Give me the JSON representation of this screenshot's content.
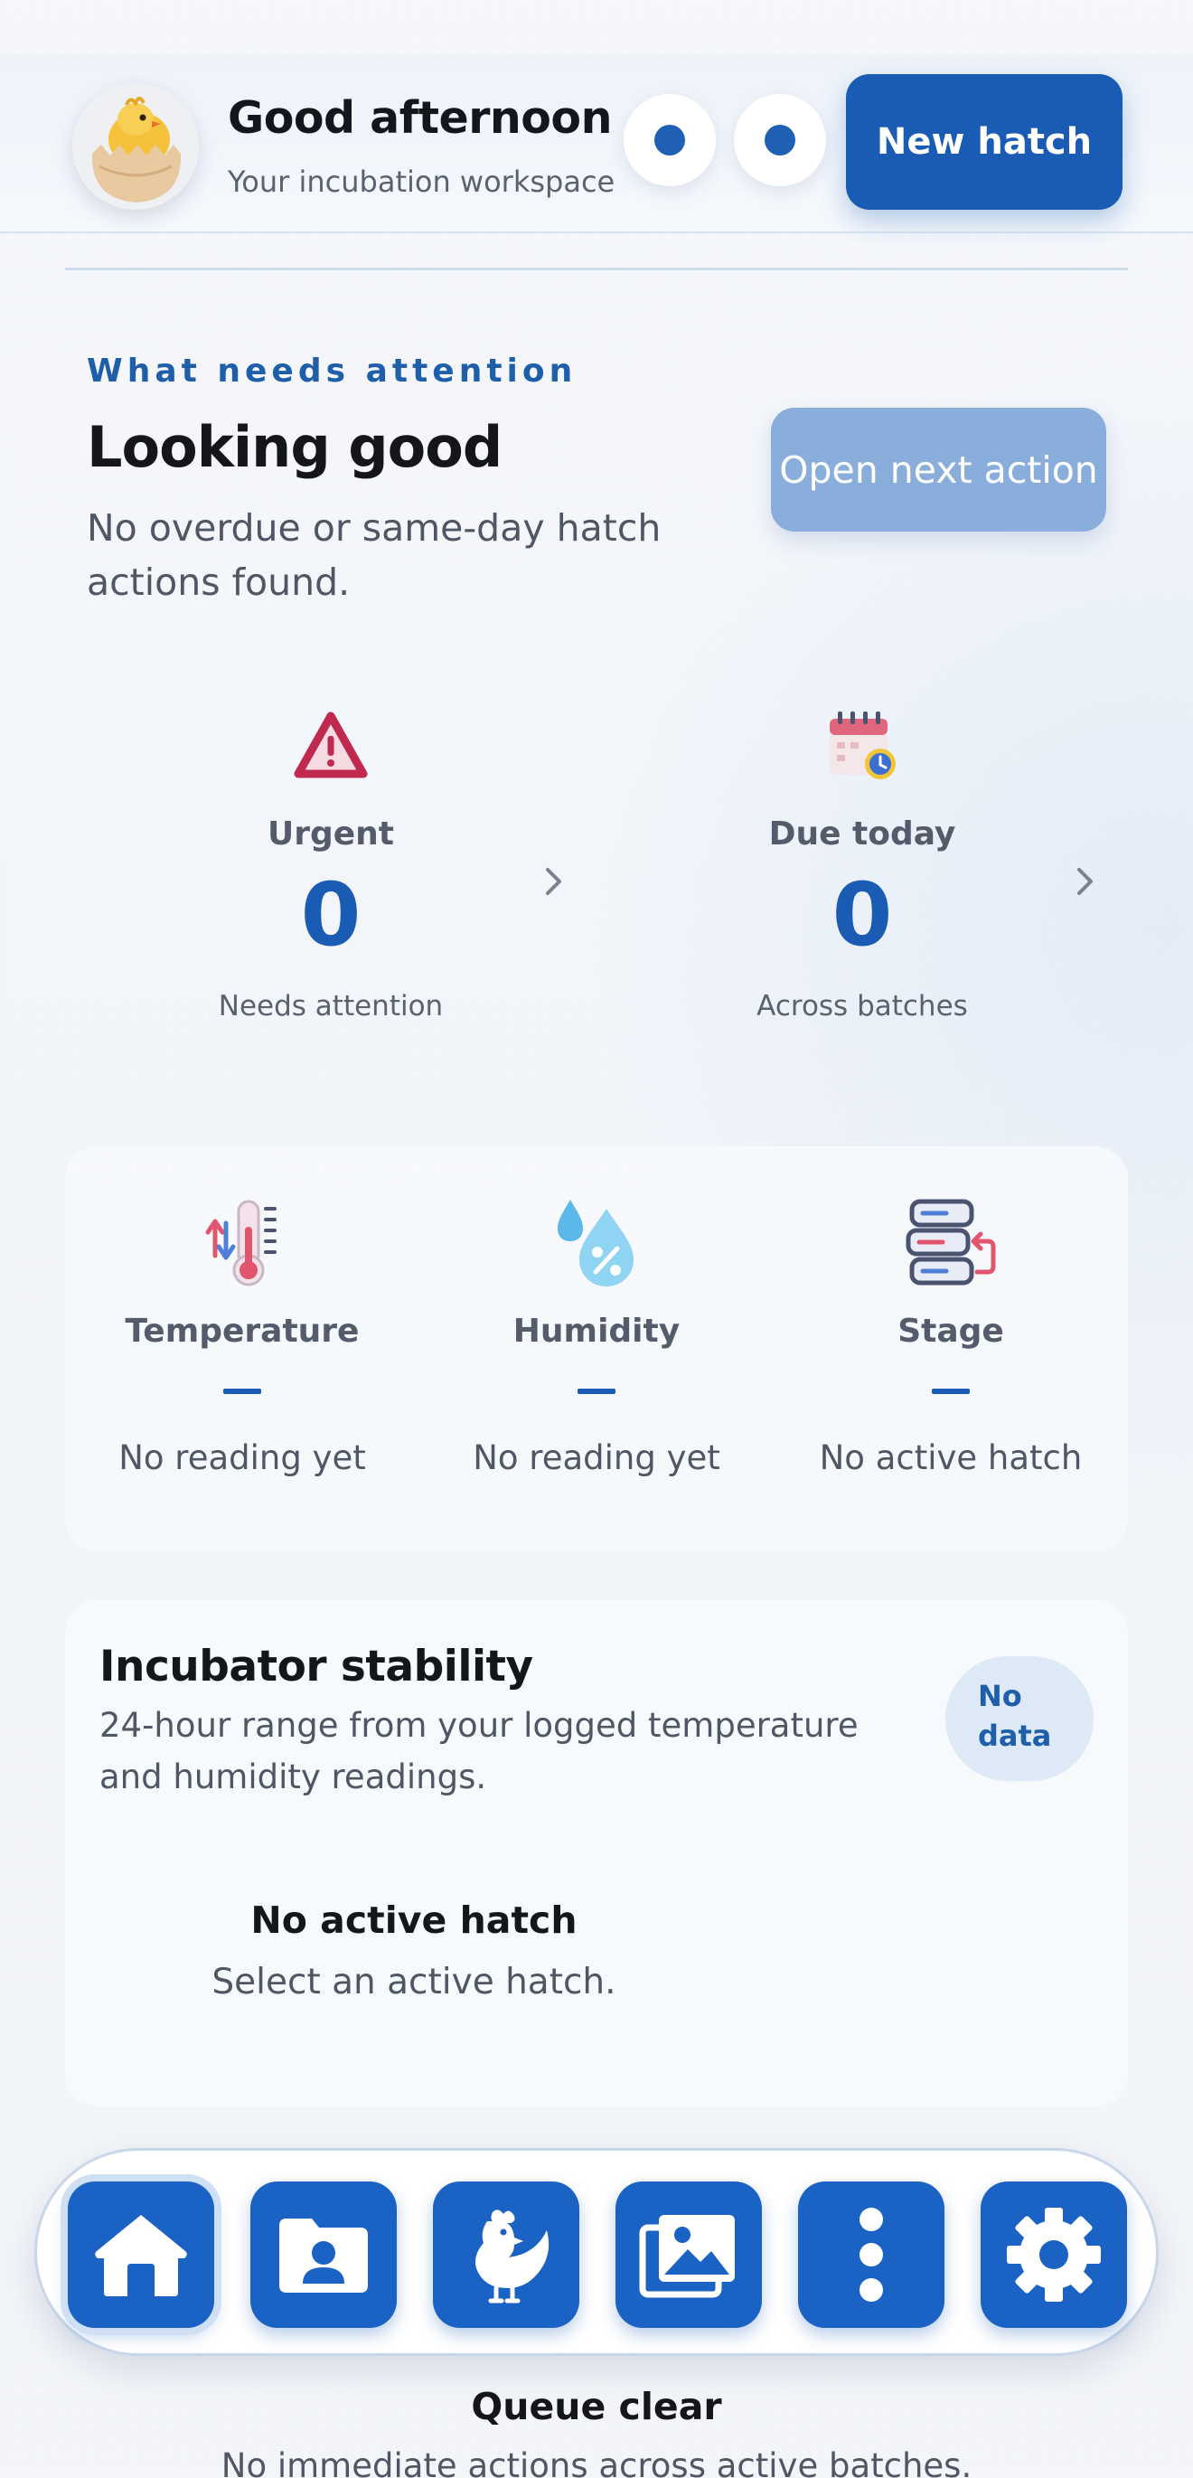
{
  "header": {
    "greeting": "Good afternoon",
    "subtitle": "Your incubation workspace",
    "new_hatch_label": "New hatch",
    "avatar_icon": "hatching-chick-icon"
  },
  "attention": {
    "eyebrow": "What needs attention",
    "title": "Looking good",
    "description": "No overdue or same-day hatch actions found.",
    "open_next_label": "Open next action"
  },
  "stats": [
    {
      "label": "Urgent",
      "value": "0",
      "caption": "Needs attention",
      "icon": "warning-triangle-icon"
    },
    {
      "label": "Due today",
      "value": "0",
      "caption": "Across batches",
      "icon": "calendar-clock-icon"
    }
  ],
  "readings": [
    {
      "label": "Temperature",
      "value": "—",
      "caption": "No reading yet",
      "icon": "thermometer-icon"
    },
    {
      "label": "Humidity",
      "value": "—",
      "caption": "No reading yet",
      "icon": "humidity-drops-icon"
    },
    {
      "label": "Stage",
      "value": "—",
      "caption": "No active hatch",
      "icon": "stage-stack-icon"
    }
  ],
  "stability": {
    "title": "Incubator stability",
    "description": "24-hour range from your logged temperature and humidity readings.",
    "badge": "No data",
    "empty_title": "No active hatch",
    "empty_description": "Select an active hatch."
  },
  "nav": [
    {
      "icon": "home-icon",
      "active": true
    },
    {
      "icon": "profile-folder-icon",
      "active": false
    },
    {
      "icon": "chicken-icon",
      "active": false
    },
    {
      "icon": "gallery-icon",
      "active": false
    },
    {
      "icon": "more-vertical-icon",
      "active": false
    },
    {
      "icon": "settings-gear-icon",
      "active": false
    }
  ],
  "queue": {
    "title": "Queue clear",
    "description": "No immediate actions across active batches."
  },
  "colors": {
    "primary": "#1a5cb3",
    "primary_disabled": "#8aaedc",
    "urgent": "#c0294f",
    "text": "#14161c",
    "muted": "#4f5664"
  }
}
